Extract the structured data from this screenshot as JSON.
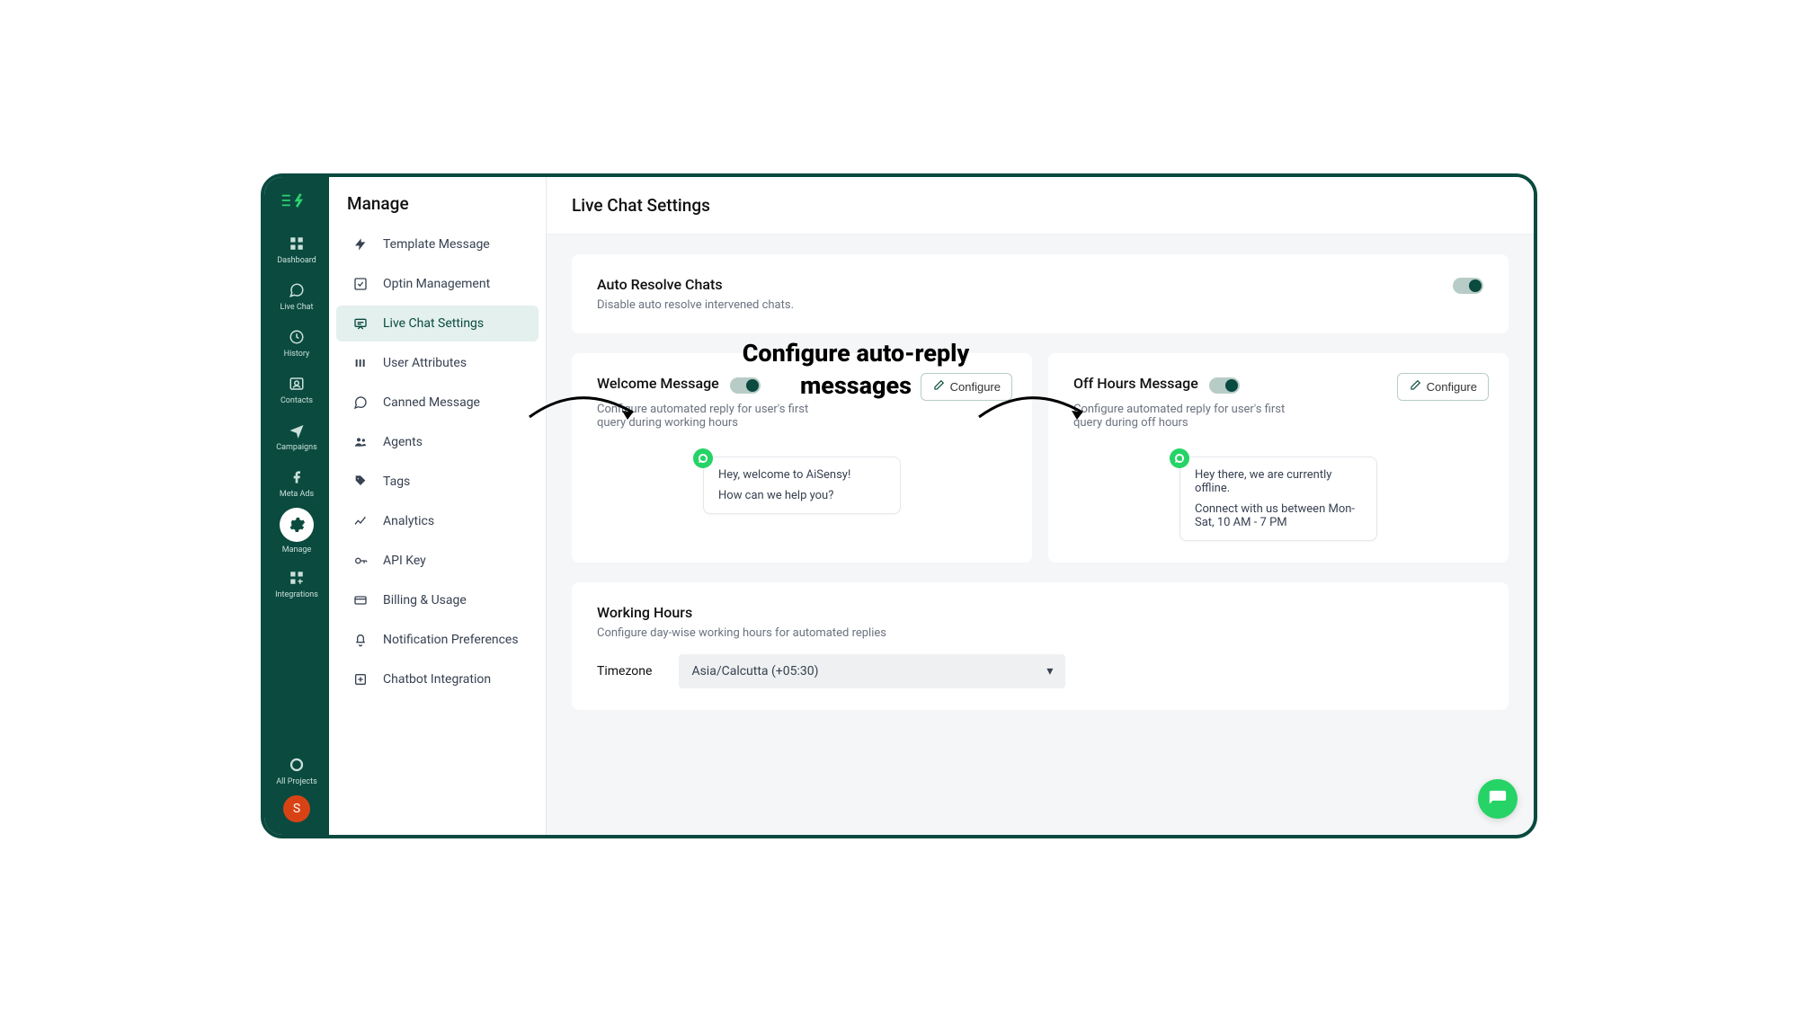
{
  "rail": {
    "items": [
      {
        "label": "Dashboard"
      },
      {
        "label": "Live Chat"
      },
      {
        "label": "History"
      },
      {
        "label": "Contacts"
      },
      {
        "label": "Campaigns"
      },
      {
        "label": "Meta Ads"
      },
      {
        "label": "Manage"
      },
      {
        "label": "Integrations"
      },
      {
        "label": "All Projects"
      }
    ],
    "avatar_letter": "S"
  },
  "sidebar": {
    "title": "Manage",
    "items": [
      {
        "label": "Template Message"
      },
      {
        "label": "Optin Management"
      },
      {
        "label": "Live Chat Settings"
      },
      {
        "label": "User Attributes"
      },
      {
        "label": "Canned Message"
      },
      {
        "label": "Agents"
      },
      {
        "label": "Tags"
      },
      {
        "label": "Analytics"
      },
      {
        "label": "API Key"
      },
      {
        "label": "Billing & Usage"
      },
      {
        "label": "Notification Preferences"
      },
      {
        "label": "Chatbot Integration"
      }
    ]
  },
  "page": {
    "title": "Live Chat Settings",
    "auto_resolve": {
      "title": "Auto Resolve Chats",
      "subtitle": "Disable auto resolve intervened chats."
    },
    "welcome": {
      "title": "Welcome Message",
      "subtitle": "Configure automated reply for user's first query during working hours",
      "configure_label": "Configure",
      "bubble_line1": "Hey, welcome to AiSensy!",
      "bubble_line2": "How can we help you?"
    },
    "offhours": {
      "title": "Off Hours Message",
      "subtitle": "Configure automated reply for user's first query during off hours",
      "configure_label": "Configure",
      "bubble_line1": "Hey there, we are currently offline.",
      "bubble_line2": "Connect with us between Mon-Sat, 10 AM - 7 PM"
    },
    "working_hours": {
      "title": "Working Hours",
      "subtitle": "Configure day-wise working hours for automated replies",
      "timezone_label": "Timezone",
      "timezone_value": "Asia/Calcutta (+05:30)"
    }
  },
  "overlay": {
    "text": "Configure auto-reply messages"
  }
}
